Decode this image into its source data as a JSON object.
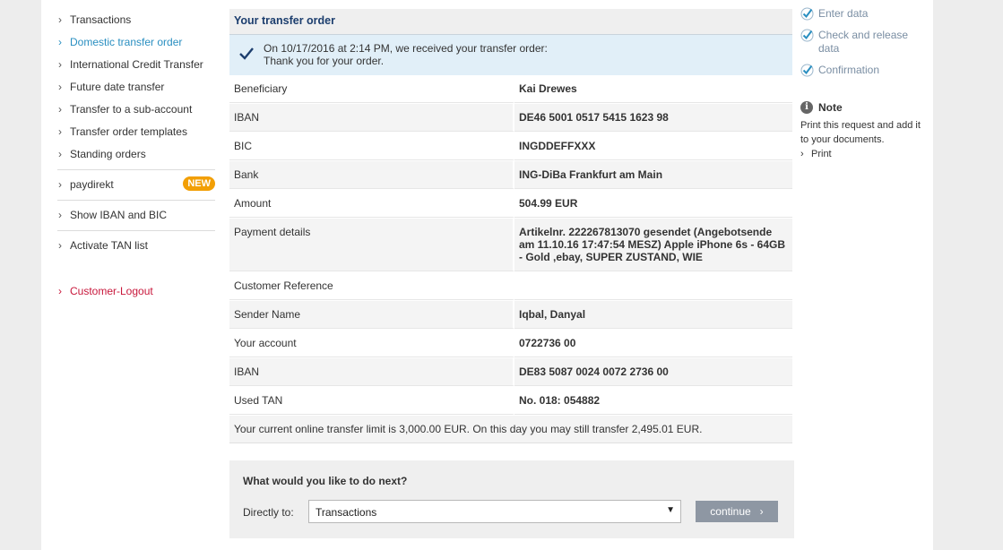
{
  "nav": {
    "items": [
      {
        "label": "Transactions"
      },
      {
        "label": "Domestic transfer order"
      },
      {
        "label": "International Credit Transfer"
      },
      {
        "label": "Future date transfer"
      },
      {
        "label": "Transfer to a sub-account"
      },
      {
        "label": "Transfer order templates"
      },
      {
        "label": "Standing orders"
      }
    ],
    "paydirekt": "paydirekt",
    "new_badge": "NEW",
    "show_iban": "Show IBAN and BIC",
    "activate_tan": "Activate TAN list",
    "logout": "Customer-Logout",
    "active_color": "#2a8fc1",
    "logout_color": "#c8173b"
  },
  "panel": {
    "title": "Your transfer order",
    "confirm_line1": "On 10/17/2016 at 2:14 PM, we received your transfer order:",
    "confirm_line2": "Thank you for your order."
  },
  "details": [
    {
      "label": "Beneficiary",
      "value": "Kai Drewes"
    },
    {
      "label": "IBAN",
      "value": "DE46 5001 0517 5415 1623 98"
    },
    {
      "label": "BIC",
      "value": "INGDDEFFXXX"
    },
    {
      "label": "Bank",
      "value": "ING-DiBa Frankfurt am Main"
    },
    {
      "label": "Amount",
      "value": "504.99 EUR"
    },
    {
      "label": "Payment details",
      "value": "Artikelnr. 222267813070 gesendet (Angebotsende am 11.10.16 17:47:54 MESZ) Apple iPhone 6s - 64GB - Gold ,ebay, SUPER ZUSTAND, WIE"
    },
    {
      "label": "Customer Reference",
      "value": ""
    },
    {
      "label": "Sender Name",
      "value": "Iqbal, Danyal"
    },
    {
      "label": "Your account",
      "value": "0722736 00"
    },
    {
      "label": "IBAN",
      "value": "DE83 5087 0024 0072 2736 00"
    },
    {
      "label": "Used TAN",
      "value": "No. 018: 054882"
    }
  ],
  "limit_text": "Your current online transfer limit is 3,000.00 EUR. On this day you may still transfer 2,495.01 EUR.",
  "next": {
    "question": "What would you like to do next?",
    "directly_to": "Directly to:",
    "selected": "Transactions",
    "continue": "continue"
  },
  "steps": [
    {
      "label": "Enter data"
    },
    {
      "label": "Check and release data"
    },
    {
      "label": "Confirmation"
    }
  ],
  "note": {
    "title": "Note",
    "body": "Print this request and add it to your documents.",
    "print": "Print"
  }
}
